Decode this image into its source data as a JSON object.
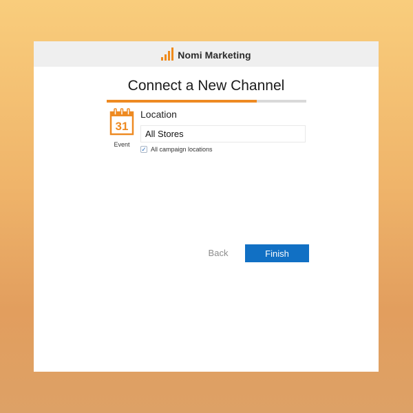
{
  "app": {
    "name": "Nomi Marketing",
    "brand_color": "#ef8a1a"
  },
  "wizard": {
    "title": "Connect a New Channel",
    "progress_fraction": 0.75,
    "progress_color": "#ee8a22",
    "channel": {
      "icon": "calendar-icon",
      "icon_day": "31",
      "label": "Event"
    },
    "location": {
      "label": "Location",
      "value": "All Stores"
    },
    "all_locations": {
      "checked": true,
      "label": "All campaign locations"
    },
    "buttons": {
      "back": "Back",
      "finish": "Finish",
      "finish_color": "#1170c4"
    }
  }
}
